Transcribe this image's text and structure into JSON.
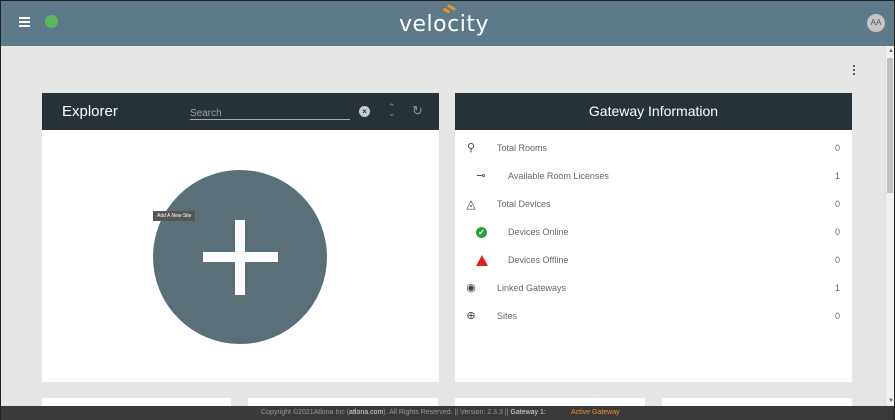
{
  "header": {
    "logo_text": "velocity",
    "avatar_initials": "AA",
    "accent_color": "#f0922b",
    "bar_color": "#5e7a88"
  },
  "explorer": {
    "title": "Explorer",
    "search_placeholder": "Search",
    "add_tooltip": "Add A New Site"
  },
  "gateway": {
    "title": "Gateway Information",
    "rows": [
      {
        "icon": "location-pin-icon",
        "label": "Total Rooms",
        "value": "0"
      },
      {
        "icon": "key-icon",
        "label": "Available Room Licenses",
        "value": "1"
      },
      {
        "icon": "devices-icon",
        "label": "Total Devices",
        "value": "0"
      },
      {
        "icon": "check-circle-icon",
        "label": "Devices Online",
        "value": "0"
      },
      {
        "icon": "warning-icon",
        "label": "Devices Offline",
        "value": "0"
      },
      {
        "icon": "globe-icon",
        "label": "Linked Gateways",
        "value": "1"
      },
      {
        "icon": "web-icon",
        "label": "Sites",
        "value": "0"
      }
    ]
  },
  "footer": {
    "copyright_prefix": "Copyright ©2021Atlona Inc (",
    "copyright_link": "atlona.com",
    "copyright_suffix": "). All Rights Reserved. || Version: 2.3.3 || ",
    "gateway_label": "Gateway 1:",
    "gateway_status": "Active Gateway"
  }
}
